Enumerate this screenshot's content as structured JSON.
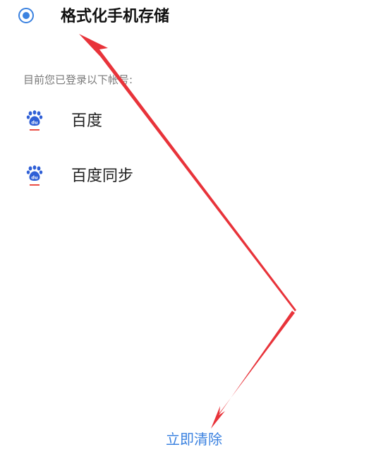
{
  "format_option": {
    "label": "格式化手机存储",
    "selected": true
  },
  "accounts_section": {
    "label": "目前您已登录以下帐号:",
    "items": [
      {
        "name": "百度",
        "icon": "baidu-paw-icon"
      },
      {
        "name": "百度同步",
        "icon": "baidu-paw-icon"
      }
    ]
  },
  "actions": {
    "clear_label": "立即清除"
  },
  "colors": {
    "accent": "#3b82e0",
    "annotation_arrow": "#e8333a",
    "icon_blue": "#2f5fd6",
    "icon_red": "#e83a30"
  }
}
